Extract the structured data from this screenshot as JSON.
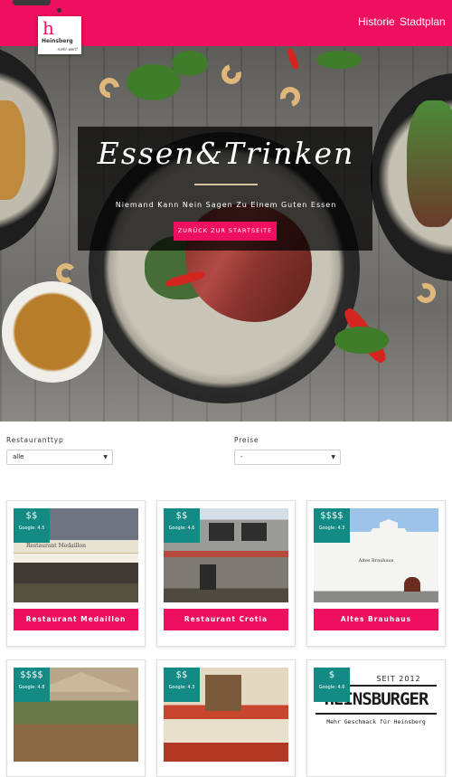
{
  "header": {
    "logo_name": "Heinsberg",
    "logo_tag": "mehr wert!",
    "nav": [
      "Historie",
      "Stadtplan"
    ]
  },
  "hero": {
    "title": "Essen&Trinken",
    "subtitle": "Niemand Kann Nein Sagen Zu Einem Guten Essen",
    "button": "ZURÜCK ZUR STARTSEITE"
  },
  "filters": {
    "type_label": "Restauranttyp",
    "type_value": "alle",
    "price_label": "Preise",
    "price_value": "-"
  },
  "restaurants": [
    {
      "name": "Restaurant Medaillon",
      "price": "$$",
      "google": "Google: 4.5",
      "sign": "Restaurant Medaillon"
    },
    {
      "name": "Restaurant Crotia",
      "price": "$$",
      "google": "Google: 4.6",
      "sign": ""
    },
    {
      "name": "Altes Brauhaus",
      "price": "$$$$",
      "google": "Google: 4.3",
      "sign": "Altes Brauhaus"
    },
    {
      "name": "",
      "price": "$$$$",
      "google": "Google: 4.8",
      "sign": ""
    },
    {
      "name": "",
      "price": "$$",
      "google": "Google: 4.3",
      "sign": ""
    },
    {
      "name": "",
      "price": "$",
      "google": "Google: 4.6",
      "sign": "SEIT 2012 HEINSBURGER Mehr Geschmack für Heinsberg"
    }
  ],
  "heinsburger": {
    "since": "SEIT 2012",
    "brand": "HEINSBURGER",
    "slogan": "Mehr Geschmack für Heinsberg"
  },
  "colors": {
    "accent": "#ee0f5e",
    "price_badge": "#148a84"
  }
}
